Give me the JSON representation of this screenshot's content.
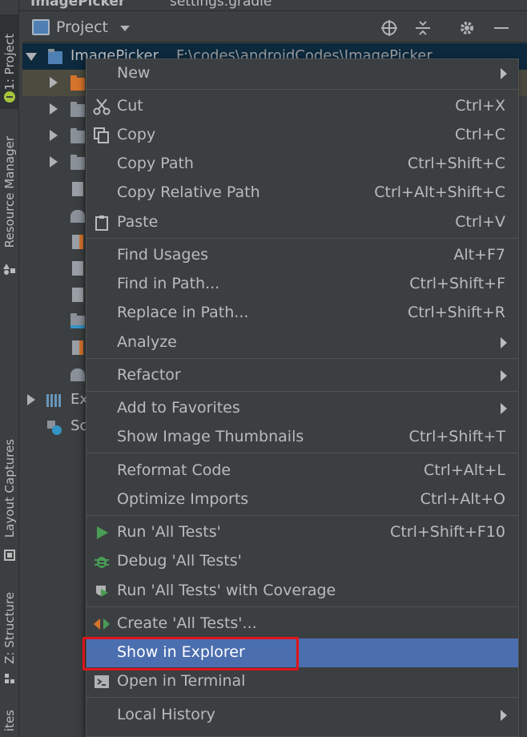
{
  "top_crumbs": {
    "project": "ImagePicker",
    "file": "settings.gradle"
  },
  "left_strip": {
    "tabs": [
      "1: Project",
      "Resource Manager",
      "Layout Captures",
      "Z: Structure",
      "ites"
    ]
  },
  "project_panel": {
    "title": "Project",
    "root_label": "ImagePicker",
    "root_path": "F:\\codes\\androidCodes\\ImagePicker",
    "ext_libs_label": "Ex",
    "scratches_label": "Sc",
    "icons": {
      "locate": "crosshair-icon",
      "collapse": "collapse-all-icon",
      "settings": "gear-icon",
      "hide": "minimize-icon"
    }
  },
  "context_menu": {
    "items": [
      {
        "label": "New",
        "shortcut": "",
        "submenu": true
      },
      {
        "label": "Cut",
        "shortcut": "Ctrl+X",
        "icon": "scissors-icon"
      },
      {
        "label": "Copy",
        "shortcut": "Ctrl+C",
        "icon": "copy-icon"
      },
      {
        "label": "Copy Path",
        "shortcut": "Ctrl+Shift+C"
      },
      {
        "label": "Copy Relative Path",
        "shortcut": "Ctrl+Alt+Shift+C"
      },
      {
        "label": "Paste",
        "shortcut": "Ctrl+V",
        "icon": "clipboard-icon"
      },
      {
        "label": "Find Usages",
        "shortcut": "Alt+F7"
      },
      {
        "label": "Find in Path...",
        "shortcut": "Ctrl+Shift+F"
      },
      {
        "label": "Replace in Path...",
        "shortcut": "Ctrl+Shift+R"
      },
      {
        "label": "Analyze",
        "shortcut": "",
        "submenu": true
      },
      {
        "label": "Refactor",
        "shortcut": "",
        "submenu": true
      },
      {
        "label": "Add to Favorites",
        "shortcut": "",
        "submenu": true
      },
      {
        "label": "Show Image Thumbnails",
        "shortcut": "Ctrl+Shift+T"
      },
      {
        "label": "Reformat Code",
        "shortcut": "Ctrl+Alt+L"
      },
      {
        "label": "Optimize Imports",
        "shortcut": "Ctrl+Alt+O"
      },
      {
        "label": "Run 'All Tests'",
        "shortcut": "Ctrl+Shift+F10",
        "icon": "run-icon"
      },
      {
        "label": "Debug 'All Tests'",
        "shortcut": "",
        "icon": "bug-icon"
      },
      {
        "label": "Run 'All Tests' with Coverage",
        "shortcut": "",
        "icon": "coverage-icon"
      },
      {
        "label": "Create 'All Tests'...",
        "shortcut": "",
        "icon": "create-test-icon"
      },
      {
        "label": "Show in Explorer",
        "shortcut": "",
        "selected": true
      },
      {
        "label": "Open in Terminal",
        "shortcut": "",
        "icon": "terminal-icon"
      },
      {
        "label": "Local History",
        "shortcut": "",
        "submenu": true
      }
    ]
  },
  "colors": {
    "highlight": "#4b6eaf",
    "annotation_box": "#e0141b",
    "background": "#3c3f41"
  }
}
